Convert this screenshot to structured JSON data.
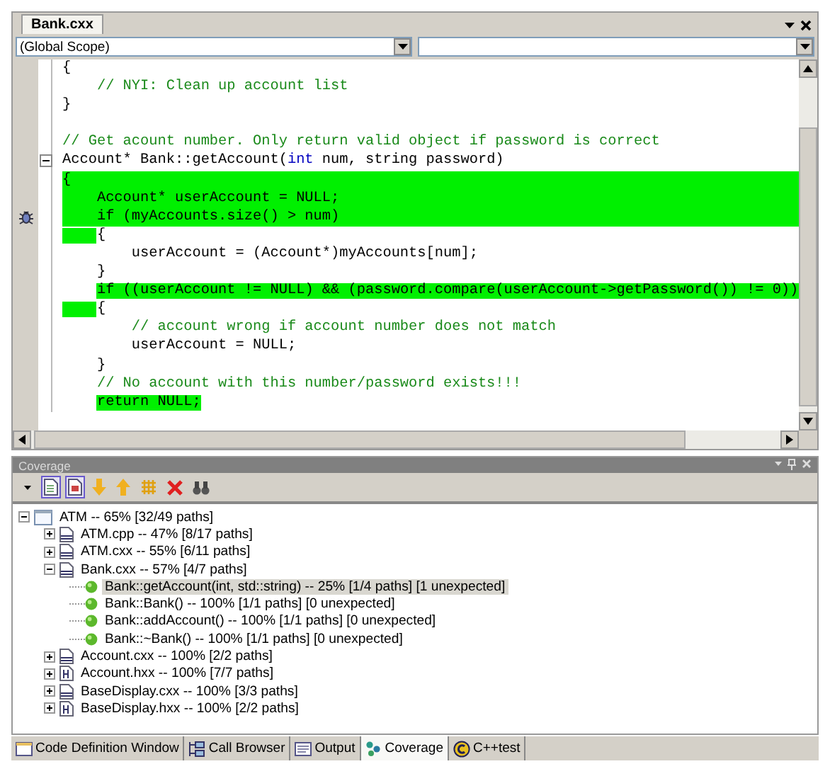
{
  "editor": {
    "tab": {
      "label": "Bank.cxx",
      "selected": true
    },
    "scope_dropdown": {
      "value": "(Global Scope)"
    },
    "lines": [
      {
        "parts": [
          {
            "text": "{",
            "kind": "plain"
          }
        ],
        "kind": "uncovered",
        "marker": false
      },
      {
        "parts": [
          {
            "text": "    // NYI: Clean up account list",
            "kind": "comment"
          }
        ],
        "kind": "uncovered",
        "marker": false
      },
      {
        "parts": [
          {
            "text": "}",
            "kind": "plain"
          }
        ],
        "kind": "uncovered",
        "marker": false
      },
      {
        "kind": "blank",
        "marker": false
      },
      {
        "parts": [
          {
            "text": "// Get acount number. Only return valid object if password is correct",
            "kind": "comment"
          }
        ],
        "kind": "uncovered",
        "marker": false
      },
      {
        "parts": [
          {
            "text": "Account* Bank::getAccount(",
            "kind": "plain"
          },
          {
            "text": "int",
            "kind": "keyword"
          },
          {
            "text": " num, string password)",
            "kind": "plain"
          }
        ],
        "kind": "uncovered",
        "marker": false,
        "expanded": true
      },
      {
        "parts": [
          {
            "text": "{",
            "kind": "plain"
          }
        ],
        "kind": "covered",
        "marker": false
      },
      {
        "parts": [
          {
            "text": "    Account* userAccount = NULL;",
            "kind": "plain"
          }
        ],
        "kind": "covered",
        "marker": false
      },
      {
        "parts": [
          {
            "text": "    if (myAccounts.size() > num)",
            "kind": "plain"
          }
        ],
        "kind": "covered",
        "marker": true
      },
      {
        "parts": [
          {
            "text": "    {",
            "kind": "plain"
          }
        ],
        "kind": "margin",
        "marker": false
      },
      {
        "parts": [
          {
            "text": "        userAccount = (Account*)myAccounts[num];",
            "kind": "plain"
          }
        ],
        "kind": "uncovered",
        "marker": false
      },
      {
        "parts": [
          {
            "text": "    }",
            "kind": "plain"
          }
        ],
        "kind": "uncovered",
        "marker": false
      },
      {
        "parts": [
          {
            "text": "    if ((userAccount != NULL) && (password.compare(userAccount->getPassword()) != 0))",
            "kind": "plain"
          }
        ],
        "kind": "statement",
        "marker": false
      },
      {
        "parts": [
          {
            "text": "    {",
            "kind": "plain"
          }
        ],
        "kind": "margin",
        "marker": false
      },
      {
        "parts": [
          {
            "text": "        // account wrong if account number does not match",
            "kind": "comment"
          }
        ],
        "kind": "uncovered",
        "marker": false
      },
      {
        "parts": [
          {
            "text": "        userAccount = NULL;",
            "kind": "plain"
          }
        ],
        "kind": "uncovered",
        "marker": false
      },
      {
        "parts": [
          {
            "text": "    }",
            "kind": "plain"
          }
        ],
        "kind": "uncovered",
        "marker": false
      },
      {
        "parts": [
          {
            "text": "    // No account with this number/password exists!!!",
            "kind": "comment"
          }
        ],
        "kind": "uncovered",
        "marker": false
      },
      {
        "parts": [
          {
            "text": "    return NULL;",
            "kind": "plain"
          }
        ],
        "kind": "statement",
        "marker": false
      }
    ]
  },
  "coverage_panel": {
    "title": "Coverage",
    "toolbar": [
      {
        "kind": "menu",
        "selected": false
      },
      {
        "kind": "document",
        "selected": true
      },
      {
        "kind": "report",
        "selected": true
      },
      {
        "kind": "down",
        "selected": false
      },
      {
        "kind": "up",
        "selected": false
      },
      {
        "kind": "grid",
        "selected": false
      },
      {
        "kind": "delete",
        "selected": false
      },
      {
        "kind": "find",
        "selected": false
      }
    ],
    "tree": [
      {
        "label": "ATM -- 65% [32/49 paths]",
        "kind": "project",
        "expanded": true,
        "selected": false,
        "children": [
          {
            "label": "ATM.cpp -- 47% [8/17 paths]",
            "kind": "source",
            "expanded": false,
            "selected": false
          },
          {
            "label": "ATM.cxx -- 55% [6/11 paths]",
            "kind": "source",
            "expanded": false,
            "selected": false
          },
          {
            "label": "Bank.cxx -- 57% [4/7 paths]",
            "kind": "source",
            "expanded": true,
            "selected": false,
            "children": [
              {
                "label": "Bank::getAccount(int, std::string) -- 25% [1/4 paths] [1 unexpected]",
                "kind": "function",
                "selected": true
              },
              {
                "label": "Bank::Bank() -- 100% [1/1 paths] [0 unexpected]",
                "kind": "function",
                "selected": false
              },
              {
                "label": "Bank::addAccount() -- 100% [1/1 paths] [0 unexpected]",
                "kind": "function",
                "selected": false
              },
              {
                "label": "Bank::~Bank() -- 100% [1/1 paths] [0 unexpected]",
                "kind": "function",
                "selected": false
              }
            ]
          },
          {
            "label": "Account.cxx -- 100% [2/2 paths]",
            "kind": "source",
            "expanded": false,
            "selected": false
          },
          {
            "label": "Account.hxx -- 100% [7/7 paths]",
            "kind": "header",
            "expanded": false,
            "selected": false
          },
          {
            "label": "BaseDisplay.cxx -- 100% [3/3 paths]",
            "kind": "source",
            "expanded": false,
            "selected": false
          },
          {
            "label": "BaseDisplay.hxx -- 100% [2/2 paths]",
            "kind": "header",
            "expanded": false,
            "selected": false
          }
        ]
      }
    ]
  },
  "bottom_tabs": [
    {
      "label": "Code Definition Window",
      "kind": "definition",
      "selected": false
    },
    {
      "label": "Call Browser",
      "kind": "browser",
      "selected": false
    },
    {
      "label": "Output",
      "kind": "output",
      "selected": false
    },
    {
      "label": "Coverage",
      "kind": "coverage",
      "selected": true
    },
    {
      "label": "C++test",
      "kind": "test",
      "selected": false
    }
  ]
}
